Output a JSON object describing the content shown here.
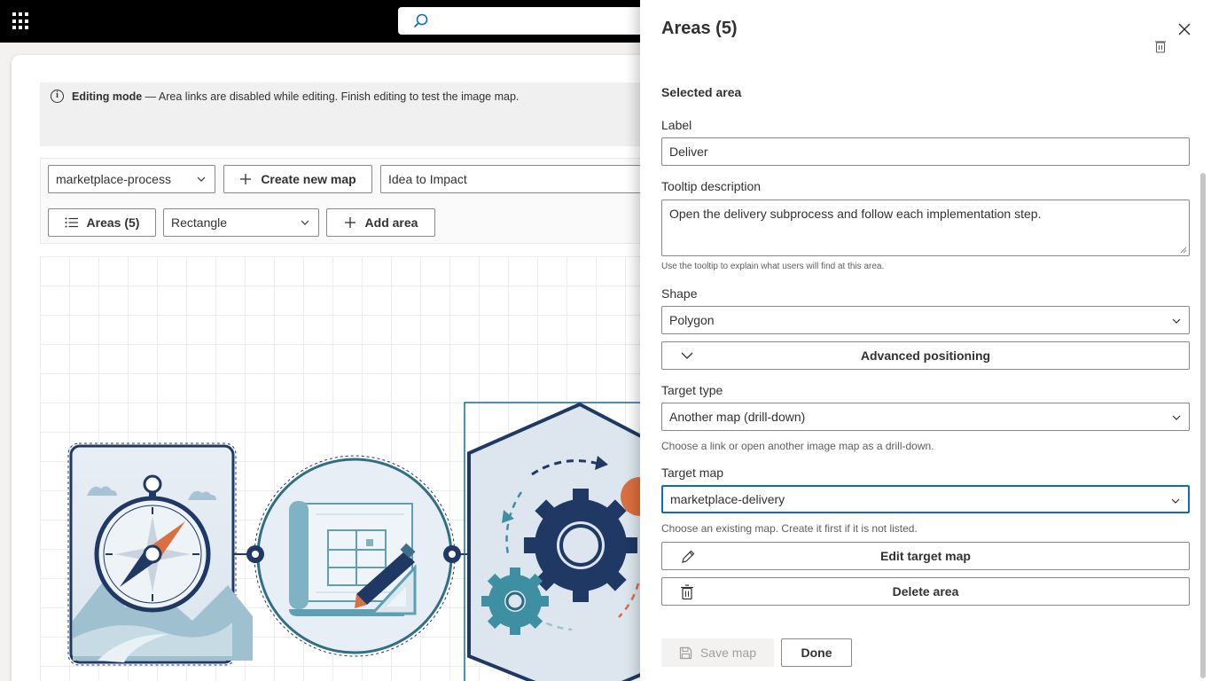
{
  "topbar": {
    "app_launcher_icon": "waffle-icon",
    "search_icon": "search-icon"
  },
  "banner": {
    "mode_label": "Editing mode",
    "message": " — Area links are disabled while editing. Finish editing to test the image map."
  },
  "toolbar": {
    "map_select_value": "marketplace-process",
    "create_map_label": "Create new map",
    "map_title_value": "Idea to Impact",
    "areas_label": "Areas (5)",
    "shape_select_value": "Rectangle",
    "add_area_label": "Add area"
  },
  "panel": {
    "title": "Areas (5)",
    "selected_area_heading": "Selected area",
    "label_heading": "Label",
    "label_value": "Deliver",
    "tooltip_heading": "Tooltip description",
    "tooltip_value": "Open the delivery subprocess and follow each implementation step.",
    "tooltip_hint": "Use the tooltip to explain what users will find at this area.",
    "shape_heading": "Shape",
    "shape_value": "Polygon",
    "advanced_label": "Advanced positioning",
    "target_type_heading": "Target type",
    "target_type_value": "Another map (drill-down)",
    "target_type_hint": "Choose a link or open another image map as a drill-down.",
    "target_map_heading": "Target map",
    "target_map_value": "marketplace-delivery",
    "target_map_hint": "Choose an existing map. Create it first if it is not listed.",
    "edit_target_label": "Edit target map",
    "delete_area_label": "Delete area",
    "save_label": "Save map",
    "done_label": "Done"
  },
  "colors": {
    "navy": "#1f3864",
    "orange": "#d9703f",
    "focus": "#0f6cbd",
    "teal": "#3f8fa3"
  }
}
